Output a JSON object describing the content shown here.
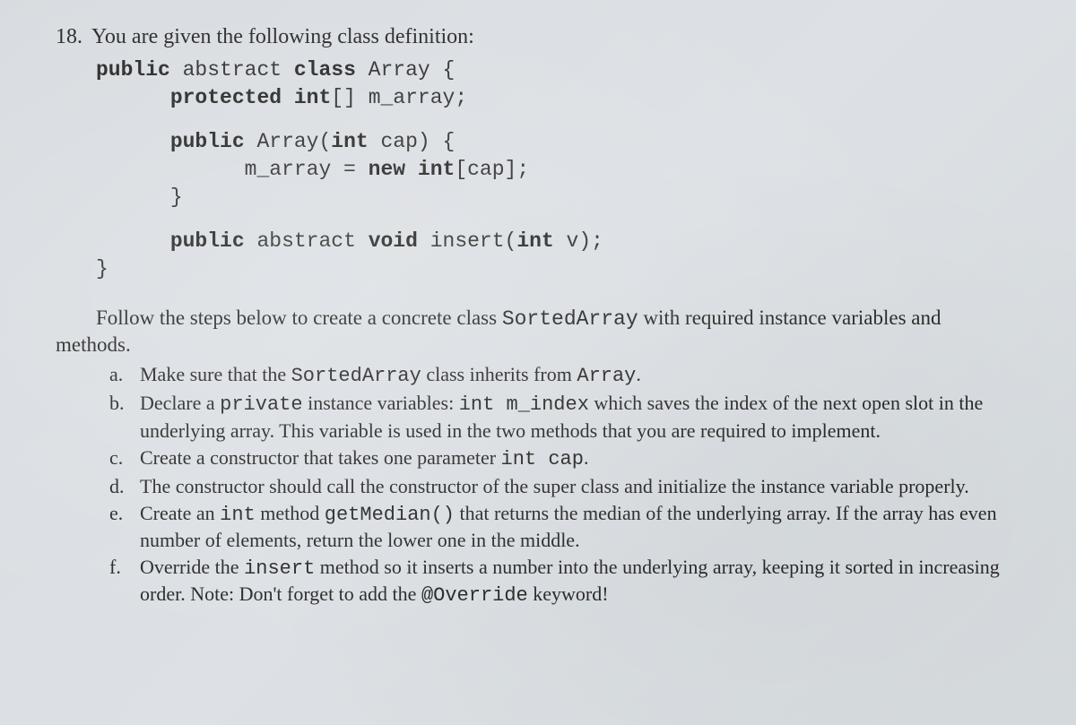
{
  "question": {
    "number": "18.",
    "intro": "You are given the following class definition:"
  },
  "code": {
    "l1_kw1": "public",
    "l1_txt1": " abstract ",
    "l1_kw2": "class",
    "l1_txt2": " Array {",
    "l2_kw1": "protected",
    "l2_txt1": " ",
    "l2_kw2": "int",
    "l2_txt2": "[] m_array;",
    "l3_kw1": "public",
    "l3_txt1": " Array(",
    "l3_kw2": "int",
    "l3_txt2": " cap) {",
    "l4_txt1": "m_array = ",
    "l4_kw1": "new",
    "l4_txt2": " ",
    "l4_kw2": "int",
    "l4_txt3": "[cap];",
    "l5": "}",
    "l6_kw1": "public",
    "l6_txt1": " abstract ",
    "l6_kw2": "void",
    "l6_txt2": " insert(",
    "l6_kw3": "int",
    "l6_txt3": " v);",
    "l7": "}"
  },
  "follow": {
    "part1": "Follow the steps below to create a concrete class ",
    "code1": "SortedArray",
    "part2": " with required instance variables and",
    "part3": "methods."
  },
  "items": {
    "a": {
      "marker": "a.",
      "t1": "Make sure that the ",
      "c1": "SortedArray",
      "t2": " class inherits from ",
      "c2": "Array",
      "t3": "."
    },
    "b": {
      "marker": "b.",
      "t1": "Declare a ",
      "c1": "private",
      "t2": " instance variables: ",
      "c2": "int m_index",
      "t3": " which saves the index of the next open slot in the underlying array. This variable is used in the two methods that you are required to implement."
    },
    "c": {
      "marker": "c.",
      "t1": "Create a constructor that takes one parameter ",
      "c1": "int cap",
      "t2": "."
    },
    "d": {
      "marker": "d.",
      "t1": "The constructor should call the constructor of the super class and initialize the instance variable properly."
    },
    "e": {
      "marker": "e.",
      "t1": "Create an ",
      "c1": "int",
      "t2": " method ",
      "c2": "getMedian()",
      "t3": " that returns the median of the underlying array. If the array has even number of elements, return the lower one in the middle."
    },
    "f": {
      "marker": "f.",
      "t1": "Override the ",
      "c1": "insert",
      "t2": " method so it inserts a number into the underlying array, keeping it sorted in increasing order. Note: Don't forget to add the ",
      "c2": "@Override",
      "t3": " keyword!"
    }
  }
}
